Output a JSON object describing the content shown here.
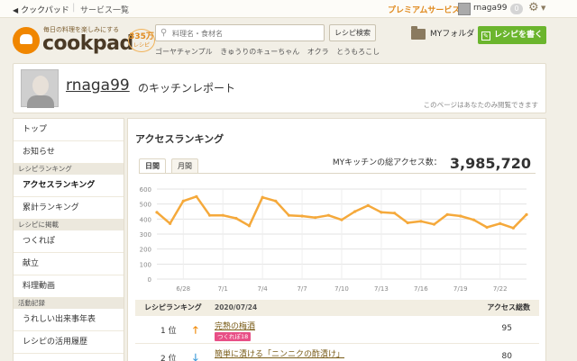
{
  "topbar": {
    "back_label": "クックパッド",
    "services_label": "サービス一覧",
    "premium_label": "プレミアムサービス",
    "username": "rnaga99",
    "badge_count": "0"
  },
  "header": {
    "logo_tagline": "毎日の料理を楽しみにする",
    "logo_text": "cookpad",
    "recipe_count": "335万",
    "recipe_count_unit": "レシピ",
    "search_placeholder": "料理名・食材名",
    "search_button": "レシピ検索",
    "keywords": [
      "ゴーヤチャンプル",
      "きゅうりのキューちゃん",
      "オクラ",
      "とうもろこし"
    ],
    "myfolder_label": "MYフォルダ",
    "write_recipe_label": "レシピを書く"
  },
  "profile": {
    "name": "rnaga99",
    "suffix": "のキッチンレポート",
    "note": "このページはあなたのみ閲覧できます"
  },
  "sidebar": {
    "items": [
      {
        "type": "item",
        "label": "トップ"
      },
      {
        "type": "item",
        "label": "お知らせ"
      },
      {
        "type": "head",
        "label": "レシピランキング"
      },
      {
        "type": "item",
        "label": "アクセスランキング",
        "active": true
      },
      {
        "type": "item",
        "label": "累計ランキング"
      },
      {
        "type": "head",
        "label": "レシピに掲載"
      },
      {
        "type": "item",
        "label": "つくれぽ"
      },
      {
        "type": "item",
        "label": "献立"
      },
      {
        "type": "item",
        "label": "料理動画"
      },
      {
        "type": "head",
        "label": "活動記録"
      },
      {
        "type": "item",
        "label": "うれしい出来事年表"
      },
      {
        "type": "item",
        "label": "レシピの活用履歴"
      }
    ]
  },
  "main": {
    "title": "アクセスランキング",
    "tabs": [
      "日間",
      "月間"
    ],
    "total_label": "MYキッチンの総アクセス数：",
    "total_value": "3,985,720",
    "ranking_header": {
      "label": "レシピランキング",
      "date": "2020/07/24",
      "count_label": "アクセス総数"
    },
    "ranking": [
      {
        "rank": "1 位",
        "trend": "up",
        "title": "完熟の梅酒",
        "tsukurepo": "つくれぽ18",
        "count": "95"
      },
      {
        "rank": "2 位",
        "trend": "down",
        "title": "簡単に漬ける「ニンニクの酢漬け」",
        "tsukurepo": "",
        "count": "80"
      }
    ]
  },
  "chart_data": {
    "type": "line",
    "x": [
      "6/26",
      "6/27",
      "6/28",
      "6/29",
      "6/30",
      "7/1",
      "7/2",
      "7/3",
      "7/4",
      "7/5",
      "7/6",
      "7/7",
      "7/8",
      "7/9",
      "7/10",
      "7/11",
      "7/12",
      "7/13",
      "7/14",
      "7/15",
      "7/16",
      "7/17",
      "7/18",
      "7/19",
      "7/20",
      "7/21",
      "7/22",
      "7/23",
      "7/24"
    ],
    "values": [
      445,
      370,
      520,
      550,
      425,
      425,
      405,
      355,
      545,
      520,
      425,
      420,
      410,
      425,
      395,
      450,
      490,
      445,
      440,
      375,
      385,
      365,
      430,
      420,
      395,
      345,
      370,
      340,
      430
    ],
    "xticks": [
      "6/28",
      "7/1",
      "7/4",
      "7/7",
      "7/10",
      "7/13",
      "7/16",
      "7/19",
      "7/22"
    ],
    "yticks": [
      0,
      100,
      200,
      300,
      400,
      500,
      600
    ],
    "ylim": [
      0,
      600
    ],
    "grid": true,
    "color": "#f5a93b"
  }
}
